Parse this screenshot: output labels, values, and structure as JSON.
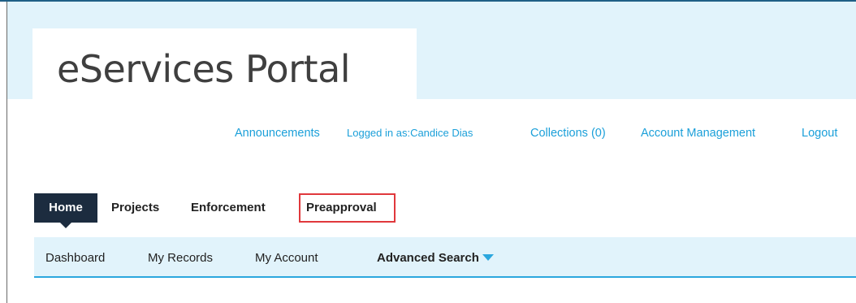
{
  "header": {
    "site_title": "eServices Portal"
  },
  "utility_links": {
    "announcements": "Announcements",
    "logged_in": "Logged in as:Candice Dias",
    "collections": "Collections (0)",
    "account_management": "Account Management",
    "logout": "Logout"
  },
  "main_tabs": {
    "home": "Home",
    "projects": "Projects",
    "enforcement": "Enforcement",
    "preapproval": "Preapproval",
    "active": "Home",
    "highlighted": "Preapproval"
  },
  "sub_nav": {
    "dashboard": "Dashboard",
    "my_records": "My Records",
    "my_account": "My Account",
    "advanced_search": "Advanced Search"
  },
  "colors": {
    "header_band": "#e1f3fb",
    "link": "#1a9fd9",
    "active_tab": "#1c2c3f",
    "highlight": "#e0383c",
    "subnav_accent": "#2ba7de"
  },
  "icons": {
    "advanced_search_dropdown": "caret-down-icon"
  }
}
